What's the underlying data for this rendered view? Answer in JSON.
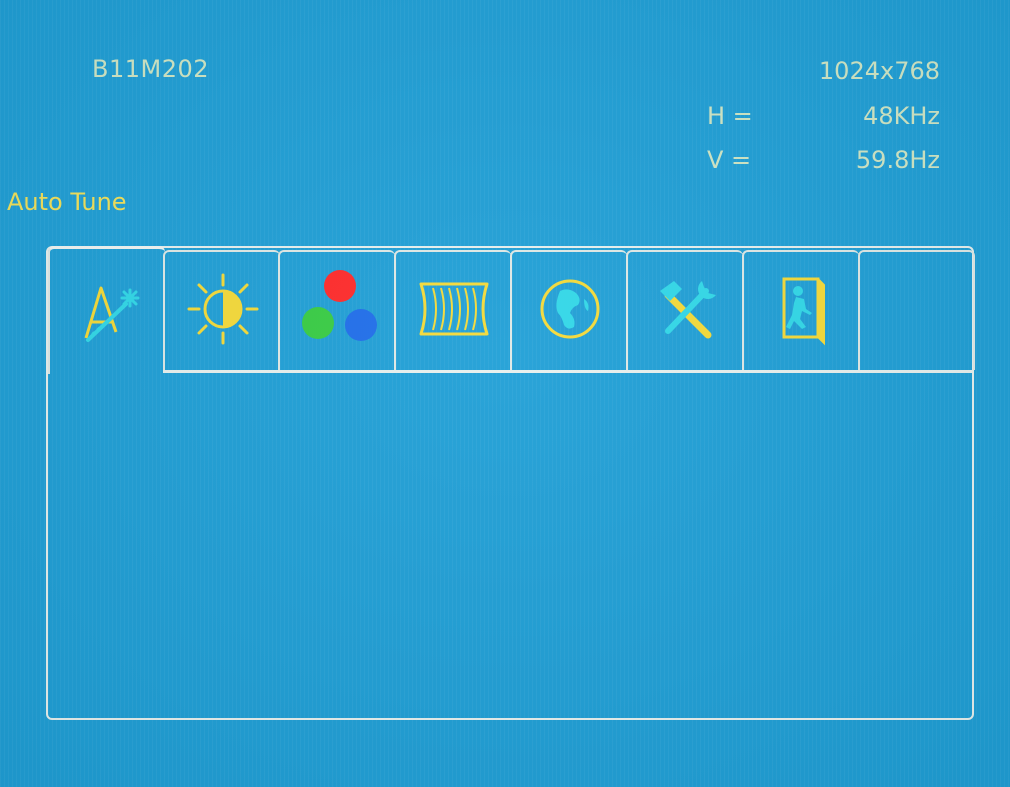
{
  "osd": {
    "model": "B11M202",
    "resolution": "1024x768",
    "h_label": "H =",
    "h_value": "48KHz",
    "v_label": "V =",
    "v_value": "59.8Hz",
    "section_title": "Auto Tune"
  },
  "tabs": [
    {
      "icon": "auto-tune-icon"
    },
    {
      "icon": "brightness-icon"
    },
    {
      "icon": "color-icon"
    },
    {
      "icon": "image-setup-icon"
    },
    {
      "icon": "language-globe-icon"
    },
    {
      "icon": "tools-icon"
    },
    {
      "icon": "exit-door-icon"
    },
    {
      "icon": ""
    }
  ],
  "colors": {
    "background": "#1f9fd6",
    "text": "#cfe6c5",
    "title": "#f1e15a",
    "icon_yellow": "#f4da39",
    "icon_cyan": "#31d8e8",
    "red": "#ff2a2a",
    "green": "#38cc44",
    "blue": "#1f6eea"
  }
}
